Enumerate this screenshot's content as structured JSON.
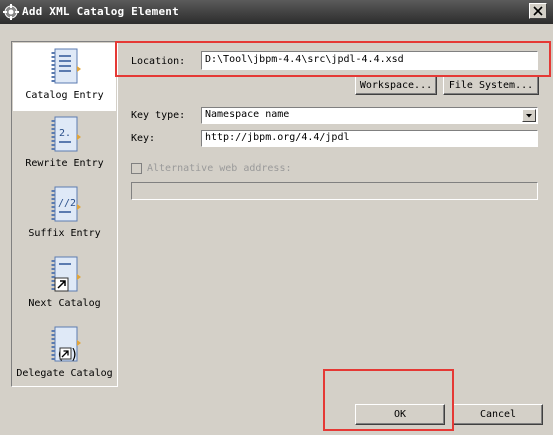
{
  "window": {
    "title": "Add XML Catalog Element",
    "close_icon": "close-icon"
  },
  "sidebar": {
    "items": [
      {
        "label": "Catalog Entry",
        "icon": "catalog-entry-icon",
        "selected": true
      },
      {
        "label": "Rewrite Entry",
        "icon": "rewrite-entry-icon",
        "selected": false
      },
      {
        "label": "Suffix Entry",
        "icon": "suffix-entry-icon",
        "selected": false
      },
      {
        "label": "Next Catalog",
        "icon": "next-catalog-icon",
        "selected": false
      },
      {
        "label": "Delegate Catalog",
        "icon": "delegate-catalog-icon",
        "selected": false
      }
    ]
  },
  "form": {
    "location_label": "Location:",
    "location_value": "D:\\Tool\\jbpm-4.4\\src\\jpdl-4.4.xsd",
    "workspace_button": "Workspace...",
    "filesystem_button": "File System...",
    "key_type_label": "Key type:",
    "key_type_value": "Namespace name",
    "key_label": "Key:",
    "key_value": "http://jbpm.org/4.4/jpdl",
    "alt_web_label": "Alternative web address:",
    "alt_web_value": ""
  },
  "footer": {
    "ok_button": "OK",
    "cancel_button": "Cancel"
  },
  "colors": {
    "highlight_box": "#e53935",
    "dialog_bg": "#d4d0c8",
    "titlebar": "#3a3a3a"
  }
}
